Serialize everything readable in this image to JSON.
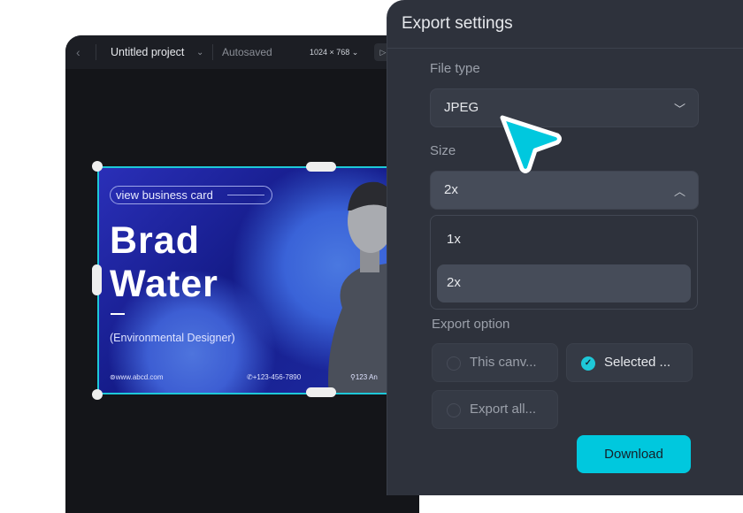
{
  "editor": {
    "project_title": "Untitled project",
    "autosave_status": "Autosaved",
    "canvas_size": "1024 × 768"
  },
  "card": {
    "link_label": "view business card",
    "first_name": "Brad",
    "last_name": "Water",
    "role": "(Environmental Designer)",
    "website": "www.abcd.com",
    "phone": "+123-456-7890",
    "address": "123 An"
  },
  "export": {
    "title": "Export settings",
    "file_type_label": "File type",
    "file_type_value": "JPEG",
    "size_label": "Size",
    "size_value": "2x",
    "size_options": [
      "1x",
      "2x"
    ],
    "size_selected": "2x",
    "export_option_label": "Export option",
    "export_options": [
      {
        "label": "This canv...",
        "checked": false
      },
      {
        "label": "Selected ...",
        "checked": true
      },
      {
        "label": "Export all...",
        "checked": false
      }
    ],
    "download_label": "Download"
  },
  "colors": {
    "accent": "#00c8de",
    "panel": "#2e323c",
    "selection": "#1ec8d8"
  }
}
